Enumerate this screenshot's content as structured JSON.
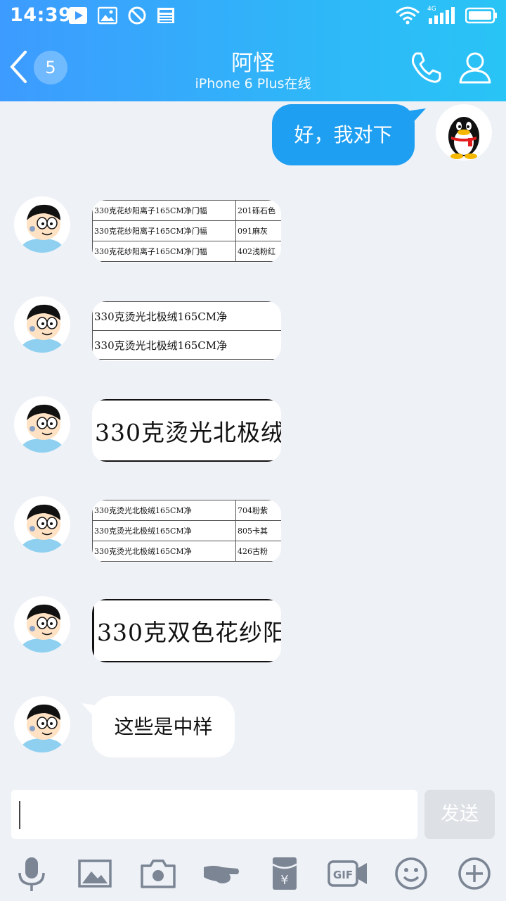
{
  "status_bar": {
    "time": "14:39",
    "network": "4G"
  },
  "header": {
    "unread_count": "5",
    "title": "阿怪",
    "subtitle": "iPhone 6 Plus在线"
  },
  "messages": {
    "outgoing": {
      "text": "好，我对下"
    },
    "img1": {
      "rows": [
        [
          "330克花纱阳离子165CM净门幅",
          "201砾石色"
        ],
        [
          "330克花纱阳离子165CM净门幅",
          "091麻灰"
        ],
        [
          "330克花纱阳离子165CM净门幅",
          "402浅粉红"
        ]
      ]
    },
    "img2": {
      "rows": [
        "330克烫光北极绒165CM净",
        "330克烫光北极绒165CM净"
      ]
    },
    "img3": {
      "text": "330克烫光北极绒"
    },
    "img4": {
      "rows": [
        [
          "330克烫光北极绒165CM净",
          "704粉紫"
        ],
        [
          "330克烫光北极绒165CM净",
          "805卡其"
        ],
        [
          "330克烫光北极绒165CM净",
          "426古粉"
        ]
      ]
    },
    "img5": {
      "text": "330克双色花纱阳"
    },
    "last_text": "这些是中样"
  },
  "input": {
    "value": "",
    "send_label": "发送"
  },
  "toolbar": {
    "gif_label": "GIF",
    "icons": [
      "microphone-icon",
      "image-icon",
      "camera-icon",
      "poke-icon",
      "red-packet-icon",
      "gif-icon",
      "emoji-icon",
      "plus-icon"
    ]
  },
  "colors": {
    "header_start": "#3d9bff",
    "header_end": "#29c4f6",
    "bubble_out": "#1e9ff2",
    "background": "#eef1f6"
  }
}
